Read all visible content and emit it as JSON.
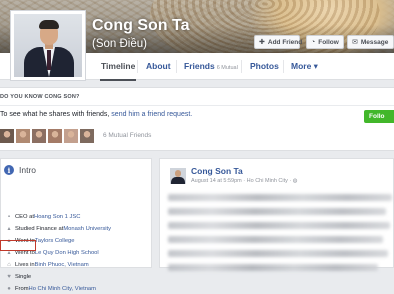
{
  "profile": {
    "name": "Cong Son Ta",
    "alternate_name": "(Son Điều)"
  },
  "cover_buttons": {
    "add_friend": "Add Friend",
    "follow": "Follow",
    "message": "Message"
  },
  "tabs": {
    "timeline": "Timeline",
    "about": "About",
    "friends": "Friends",
    "friends_sub": "6 Mutual",
    "photos": "Photos",
    "more": "More ▾"
  },
  "do_you_know": {
    "title": "DO YOU KNOW CONG SON?",
    "text": "To see what he shares with friends,",
    "link": "send him a friend request.",
    "follow_button": "Follo",
    "mutual_friends": "6 Mutual Friends",
    "mutual_colors": [
      "#6d5a4e",
      "#b08a72",
      "#8c6f62",
      "#a47b67",
      "#c3a08e",
      "#7e6a5e"
    ]
  },
  "intro": {
    "title": "Intro",
    "items": [
      {
        "icon": "briefcase-icon",
        "glyph": "▪",
        "prefix": "CEO at ",
        "link": "Hoang Son 1 JSC"
      },
      {
        "icon": "graduation-cap-icon",
        "glyph": "▴",
        "prefix": "Studied Finance at ",
        "link": "Monash University"
      },
      {
        "icon": "graduation-cap-icon",
        "glyph": "▴",
        "prefix": "Went to ",
        "link": "Taylors College"
      },
      {
        "icon": "graduation-cap-icon",
        "glyph": "▴",
        "prefix": "Went to ",
        "link": "Le Quy Don High School"
      },
      {
        "icon": "home-icon",
        "glyph": "⌂",
        "prefix": "Lives in ",
        "link": "Binh Phuoc, Vietnam"
      },
      {
        "icon": "heart-icon",
        "glyph": "♥",
        "prefix": "Single",
        "link": ""
      },
      {
        "icon": "location-pin-icon",
        "glyph": "●",
        "prefix": "From ",
        "link": "Ho Chi Minh City, Vietnam"
      }
    ]
  },
  "post": {
    "author": "Cong Son Ta",
    "meta": "August 14 at 5:59pm · Ho Chi Minh City · ",
    "globe": "◍"
  }
}
